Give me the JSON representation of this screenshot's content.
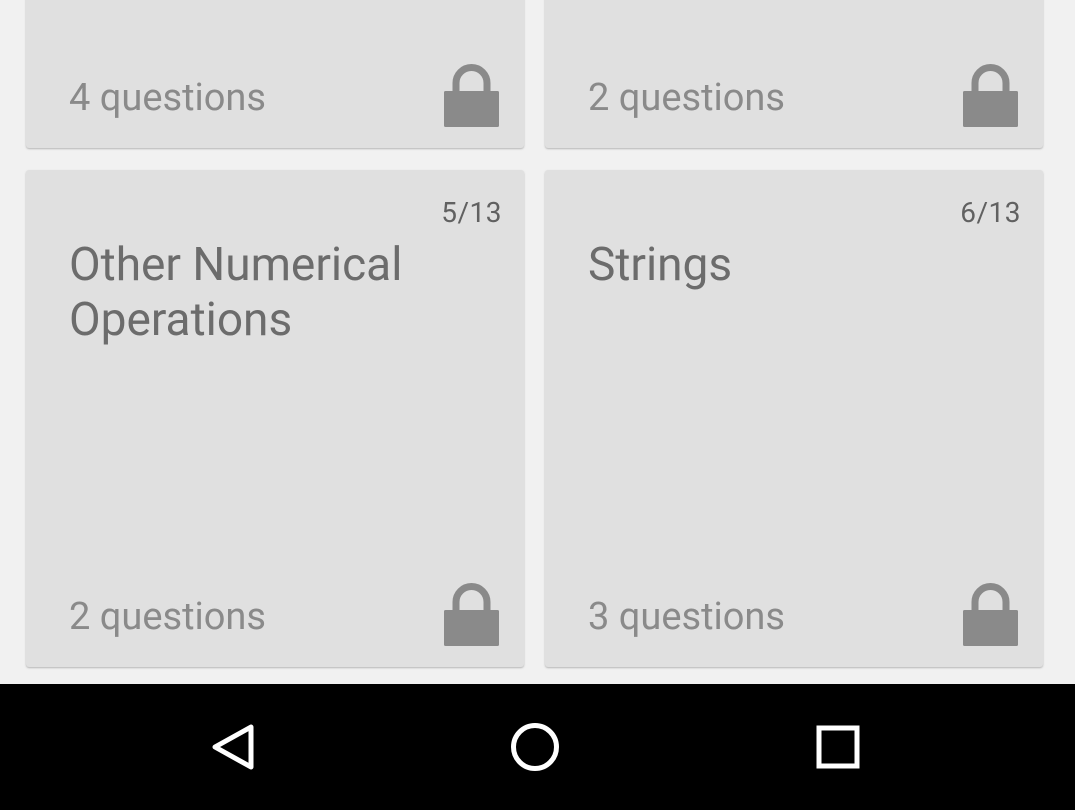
{
  "colors": {
    "background": "#f1f1f1",
    "card": "#e0e0e0",
    "lock": "#8a8a8a",
    "navbar": "#000000",
    "nav_icon": "#ffffff"
  },
  "cards": [
    {
      "progress": "",
      "title": "",
      "questions": "4 questions",
      "locked": true,
      "icon": "lock-icon"
    },
    {
      "progress": "",
      "title": "",
      "questions": "2 questions",
      "locked": true,
      "icon": "lock-icon"
    },
    {
      "progress": "5/13",
      "title": "Other Numerical Operations",
      "questions": "2 questions",
      "locked": true,
      "icon": "lock-icon"
    },
    {
      "progress": "6/13",
      "title": "Strings",
      "questions": "3 questions",
      "locked": true,
      "icon": "lock-icon"
    }
  ],
  "navbar": {
    "buttons": [
      {
        "icon": "back-triangle-icon"
      },
      {
        "icon": "home-circle-icon"
      },
      {
        "icon": "recents-square-icon"
      }
    ]
  }
}
